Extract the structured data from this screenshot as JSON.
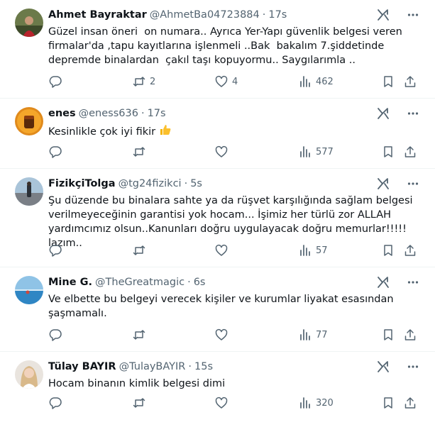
{
  "tweets": [
    {
      "name": "Ahmet Bayraktar",
      "handle": "@AhmetBa04723884",
      "separator": "·",
      "time": "17s",
      "text": "Güzel insan öneri  on numara.. Ayrıca Yer-Yapı güvenlik belgesi veren firmalar'da ,tapu kayıtlarına işlenmeli ..Bak  bakalım 7.şiddetinde depremde binalardan  çakıl taşı kopuyormu.. Saygılarımla ..",
      "retweets": "2",
      "likes": "4",
      "views": "462"
    },
    {
      "name": "enes",
      "handle": "@eness636",
      "separator": "·",
      "time": "17s",
      "text": "Kesinlikle çok iyi fikir ",
      "emoji_icon": "thumbs-up-emoji",
      "retweets": "",
      "likes": "",
      "views": "577"
    },
    {
      "name": "FizikçiTolga",
      "handle": "@tg24fizikci",
      "separator": "·",
      "time": "5s",
      "text": "Şu düzende bu binalara sahte ya da rüşvet karşılığında sağlam belgesi verilmeyeceğinin garantisi yok hocam... İşimiz her türlü zor ALLAH yardımcımız olsun..Kanunları doğru uygulayacak doğru memurlar!!!!! lazım..",
      "retweets": "",
      "likes": "",
      "views": "57"
    },
    {
      "name": "Mine G.",
      "handle": "@TheGreatmagic",
      "separator": "·",
      "time": "6s",
      "text": "Ve elbette bu belgeyi verecek kişiler ve kurumlar liyakat esasından şaşmamalı.",
      "retweets": "",
      "likes": "",
      "views": "77"
    },
    {
      "name": "Tülay BAYIR",
      "handle": "@TulayBAYIR",
      "separator": "·",
      "time": "15s",
      "text": "Hocam binanın kimlik belgesi dimi",
      "retweets": "",
      "likes": "",
      "views": "320"
    }
  ],
  "icons": {
    "reply": "reply-icon",
    "retweet": "retweet-icon",
    "like": "like-icon",
    "views": "views-icon",
    "bookmark": "bookmark-icon",
    "share": "share-icon",
    "grok": "grok-icon",
    "more": "more-icon"
  },
  "colors": {
    "text": "#0f1419",
    "secondary": "#536471",
    "divider": "#eff3f4"
  }
}
